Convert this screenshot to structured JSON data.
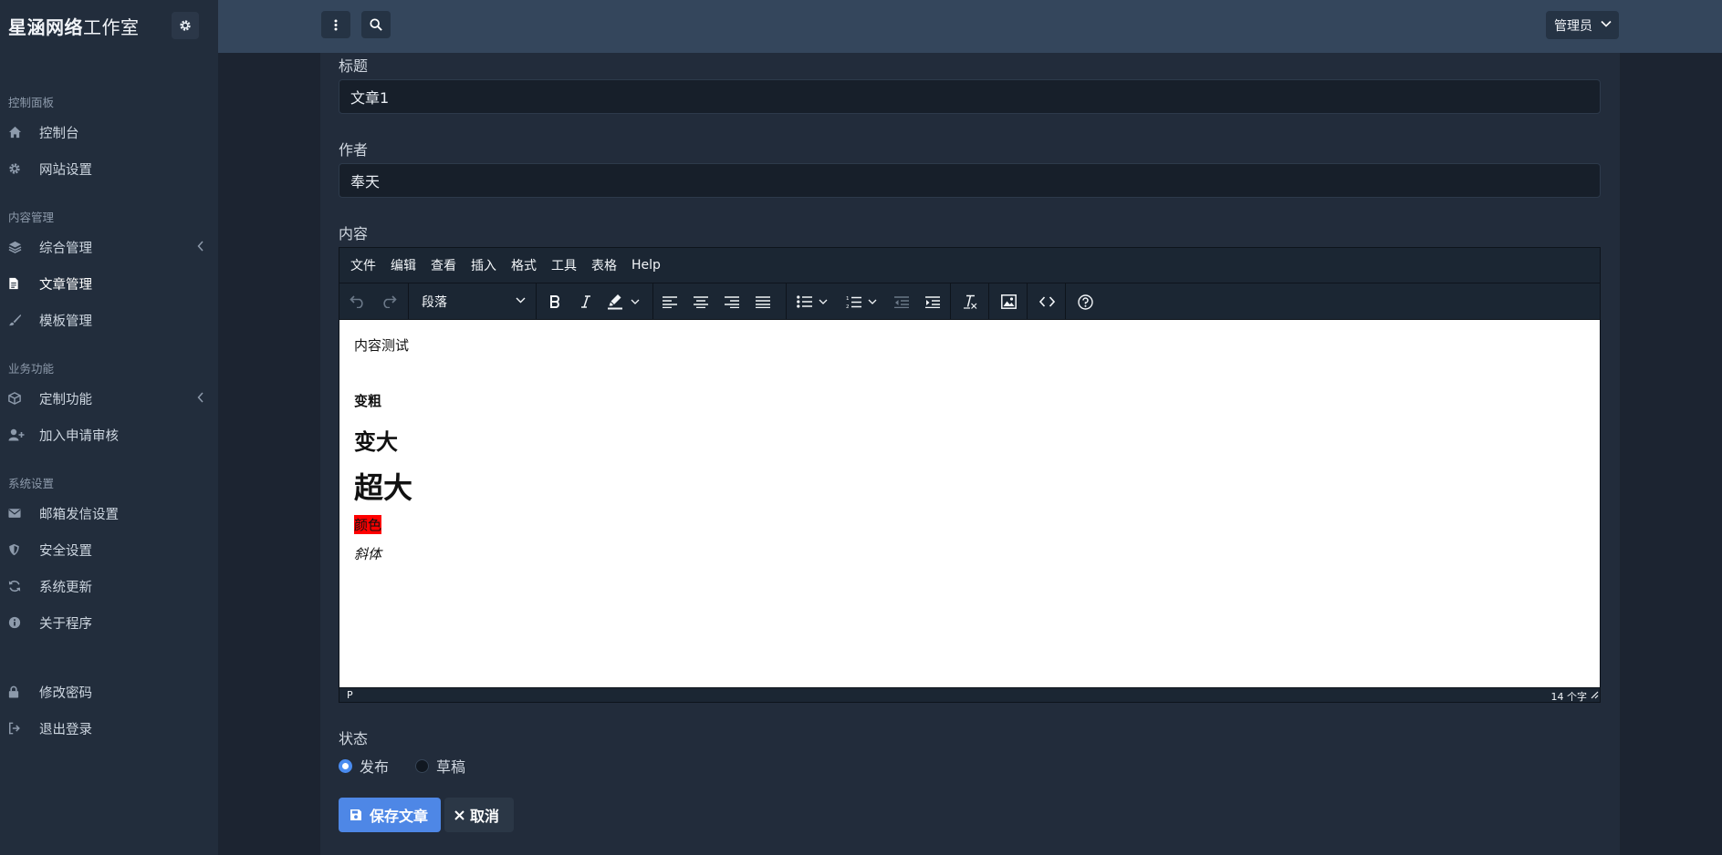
{
  "brand": {
    "name_bold": "星涵网络",
    "name_rest": "工作室"
  },
  "sidebar": {
    "sections": [
      {
        "title": "控制面板",
        "items": [
          {
            "label": "控制台",
            "icon": "home-icon"
          },
          {
            "label": "网站设置",
            "icon": "gear-icon"
          }
        ]
      },
      {
        "title": "内容管理",
        "items": [
          {
            "label": "综合管理",
            "icon": "layers-icon",
            "has_submenu": true
          },
          {
            "label": "文章管理",
            "icon": "file-icon",
            "active": true
          },
          {
            "label": "模板管理",
            "icon": "brush-icon"
          }
        ]
      },
      {
        "title": "业务功能",
        "items": [
          {
            "label": "定制功能",
            "icon": "cube-icon",
            "has_submenu": true
          },
          {
            "label": "加入申请审核",
            "icon": "user-plus-icon"
          }
        ]
      },
      {
        "title": "系统设置",
        "items": [
          {
            "label": "邮箱发信设置",
            "icon": "envelope-icon"
          },
          {
            "label": "安全设置",
            "icon": "shield-icon"
          },
          {
            "label": "系统更新",
            "icon": "sync-icon"
          },
          {
            "label": "关于程序",
            "icon": "info-icon"
          }
        ]
      }
    ],
    "bottom": [
      {
        "label": "修改密码",
        "icon": "lock-icon"
      },
      {
        "label": "退出登录",
        "icon": "logout-icon"
      }
    ]
  },
  "topbar": {
    "admin_label": "管理员"
  },
  "form": {
    "title_label": "标题",
    "title_value": "文章1",
    "author_label": "作者",
    "author_value": "奉天",
    "content_label": "内容",
    "status_label": "状态",
    "status_options": [
      {
        "label": "发布",
        "checked": true
      },
      {
        "label": "草稿",
        "checked": false
      }
    ],
    "save_label": "保存文章",
    "cancel_label": "取消"
  },
  "editor": {
    "menu": [
      "文件",
      "编辑",
      "查看",
      "插入",
      "格式",
      "工具",
      "表格",
      "Help"
    ],
    "block_format": "段落",
    "content": {
      "line1": "内容测试",
      "bold": "变粗",
      "big": "变大",
      "huge": "超大",
      "colored": "颜色",
      "italic": "斜体"
    },
    "status_path": "P",
    "word_count": "14 个字",
    "highlight_color": "#ff0000"
  },
  "colors": {
    "primary": "#4e87e6",
    "sidebar_bg": "#222d3c",
    "topbar_bg": "#34465c"
  }
}
